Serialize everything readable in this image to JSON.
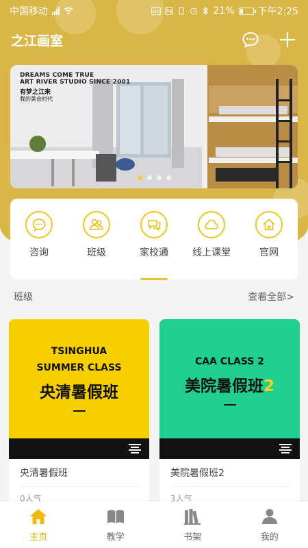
{
  "status_bar": {
    "carrier": "中国移动",
    "battery_percent": "21%",
    "time": "下午2:25"
  },
  "header": {
    "title": "之江画室",
    "icons": [
      "chat-icon",
      "add-icon"
    ]
  },
  "banner": {
    "line1": "DREAMS COME TRUE",
    "line2": "ART RIVER STUDIO SINCE 2001",
    "line3": "有梦之江来",
    "line4": "我的美会时代",
    "slide_count": 4,
    "active_slide": 1
  },
  "nav": {
    "items": [
      {
        "label": "咨询",
        "icon": "consult-icon"
      },
      {
        "label": "班级",
        "icon": "class-icon"
      },
      {
        "label": "家校通",
        "icon": "home-school-icon"
      },
      {
        "label": "线上课堂",
        "icon": "online-class-icon"
      },
      {
        "label": "官网",
        "icon": "website-icon"
      }
    ],
    "selected_index": 2
  },
  "section": {
    "title": "班级",
    "more": "查看全部>"
  },
  "classes": [
    {
      "cover_en1": "TSINGHUA",
      "cover_en2": "SUMMER CLASS",
      "cover_cn": "央清暑假班",
      "name": "央清暑假班",
      "count": "0人气",
      "color": "#f7cf00"
    },
    {
      "cover_en1": "CAA CLASS 2",
      "cover_cn": "美院暑假班",
      "cover_cn_suffix": "2",
      "name": "美院暑假班2",
      "count": "3人气",
      "color": "#20cf90"
    }
  ],
  "tabbar": {
    "items": [
      {
        "label": "主页",
        "icon": "home-icon",
        "active": true
      },
      {
        "label": "教学",
        "icon": "book-icon",
        "active": false
      },
      {
        "label": "书架",
        "icon": "bookshelf-icon",
        "active": false
      },
      {
        "label": "我的",
        "icon": "user-icon",
        "active": false
      }
    ],
    "accent": "#e7b000"
  }
}
